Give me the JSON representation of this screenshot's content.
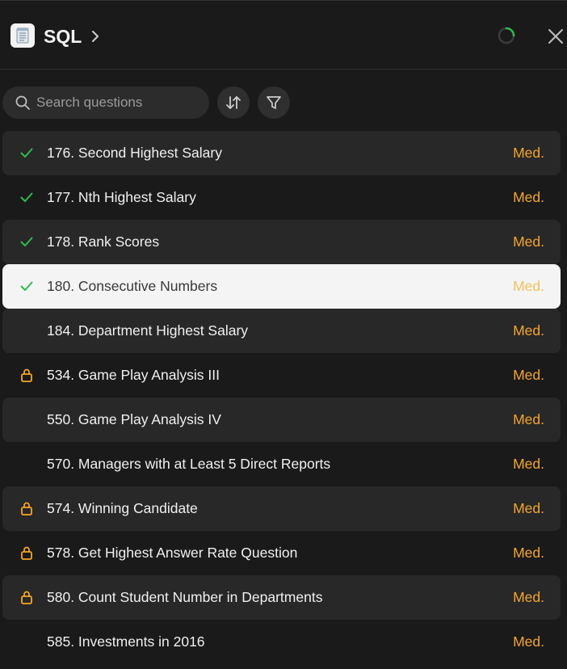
{
  "header": {
    "title": "SQL",
    "icon": "notebook-icon"
  },
  "toolbar": {
    "search_placeholder": "Search questions",
    "search_value": "",
    "sort_icon": "sort-arrows-icon",
    "filter_icon": "filter-icon"
  },
  "colors": {
    "check": "#2cbc4f",
    "lock": "#f5a623",
    "medium": "#f5a623"
  },
  "questions": [
    {
      "title": "176. Second Highest Salary",
      "difficulty": "Med.",
      "status": "solved"
    },
    {
      "title": "177. Nth Highest Salary",
      "difficulty": "Med.",
      "status": "solved"
    },
    {
      "title": "178. Rank Scores",
      "difficulty": "Med.",
      "status": "solved"
    },
    {
      "title": "180. Consecutive Numbers",
      "difficulty": "Med.",
      "status": "solved",
      "selected": true
    },
    {
      "title": "184. Department Highest Salary",
      "difficulty": "Med.",
      "status": "none"
    },
    {
      "title": "534. Game Play Analysis III",
      "difficulty": "Med.",
      "status": "locked"
    },
    {
      "title": "550. Game Play Analysis IV",
      "difficulty": "Med.",
      "status": "none"
    },
    {
      "title": "570. Managers with at Least 5 Direct Reports",
      "difficulty": "Med.",
      "status": "none"
    },
    {
      "title": "574. Winning Candidate",
      "difficulty": "Med.",
      "status": "locked"
    },
    {
      "title": "578. Get Highest Answer Rate Question",
      "difficulty": "Med.",
      "status": "locked"
    },
    {
      "title": "580. Count Student Number in Departments",
      "difficulty": "Med.",
      "status": "locked"
    },
    {
      "title": "585. Investments in 2016",
      "difficulty": "Med.",
      "status": "none"
    }
  ]
}
